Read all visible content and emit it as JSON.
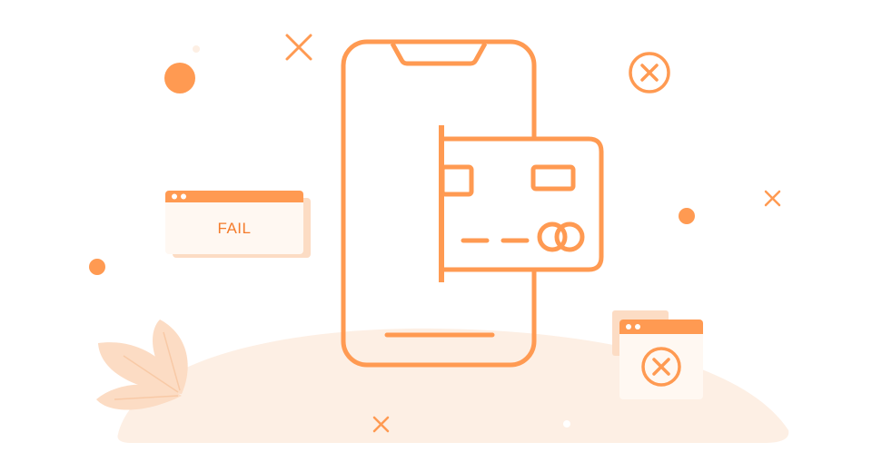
{
  "fail_window": {
    "label": "FAIL"
  },
  "icons": {
    "phone": "smartphone-icon",
    "card": "credit-card-icon",
    "error_window": "error-window-icon",
    "fail_window": "fail-window-icon",
    "leaves": "leaves-icon",
    "x_marks": "close-icon",
    "circle_x": "circle-x-icon",
    "dots": "dot-icon"
  },
  "colors": {
    "accent": "#FF9A52",
    "accent_dark": "#F47B2A",
    "light": "#FDEFE4",
    "leaf": "#FCDCC4",
    "window_bg": "#FFF8F2",
    "white": "#FFFFFF"
  }
}
